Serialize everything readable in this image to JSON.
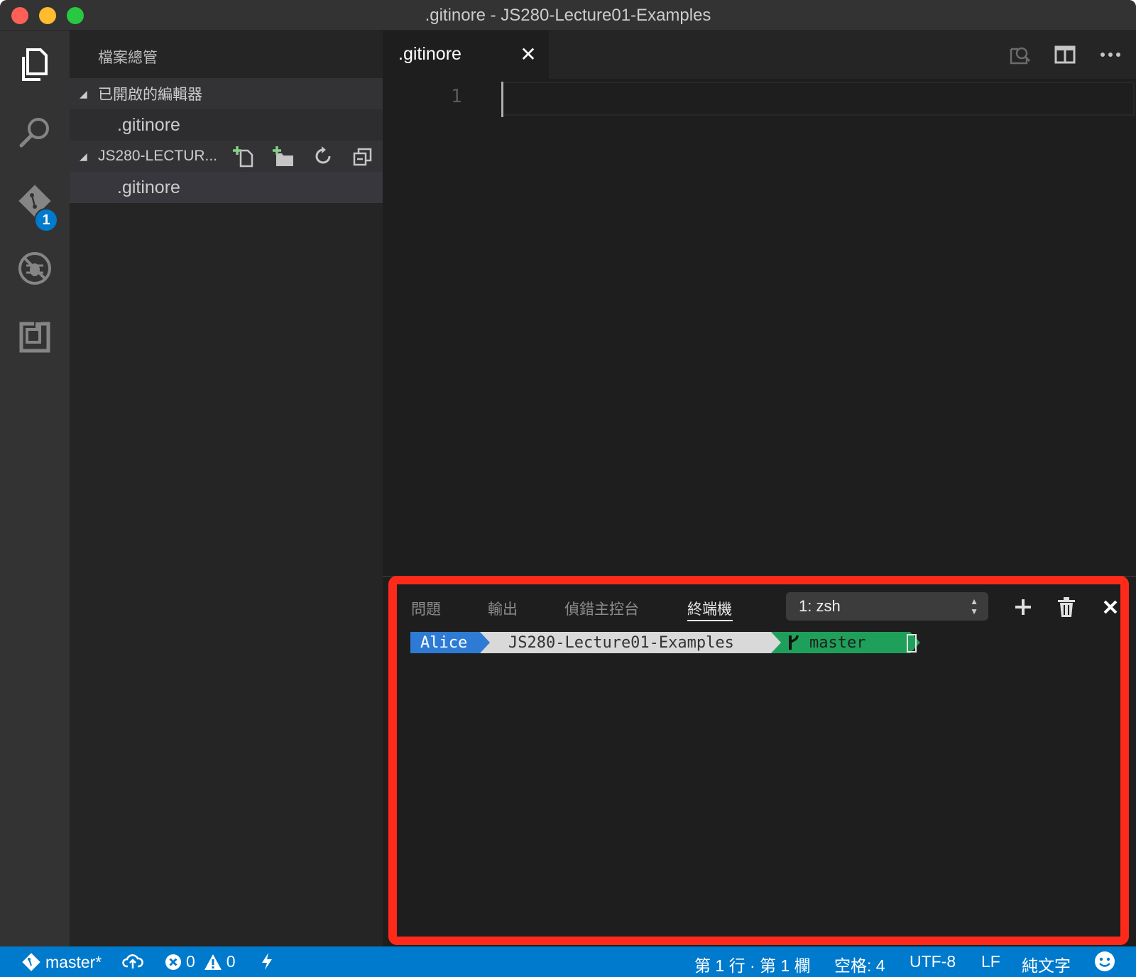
{
  "window": {
    "title": ".gitinore - JS280-Lecture01-Examples"
  },
  "activity_bar": {
    "scm_badge": "1"
  },
  "sidebar": {
    "title": "檔案總管",
    "open_editors": {
      "label": "已開啟的編輯器",
      "files": [
        ".gitinore"
      ]
    },
    "project": {
      "label": "JS280-LECTUR...",
      "files": [
        ".gitinore"
      ]
    }
  },
  "editor": {
    "tab_label": ".gitinore",
    "tab_close": "✕",
    "line_number": "1"
  },
  "panel": {
    "tabs": [
      "問題",
      "輸出",
      "偵錯主控台",
      "終端機"
    ],
    "active_tab": "終端機",
    "terminal_select": "1: zsh",
    "prompt": {
      "user": "Alice",
      "dir": "JS280-Lecture01-Examples",
      "branch": "master"
    }
  },
  "status_bar": {
    "branch": "master*",
    "errors": "0",
    "warnings": "0",
    "position": "第 1 行 · 第 1 欄",
    "indent": "空格: 4",
    "encoding": "UTF-8",
    "eol": "LF",
    "language": "純文字"
  },
  "colors": {
    "accent": "#007acc",
    "highlight_box": "#ff2a1a",
    "prompt_user": "#2e7bd6",
    "prompt_dir": "#d9d9d9",
    "prompt_git": "#1fa05a"
  }
}
